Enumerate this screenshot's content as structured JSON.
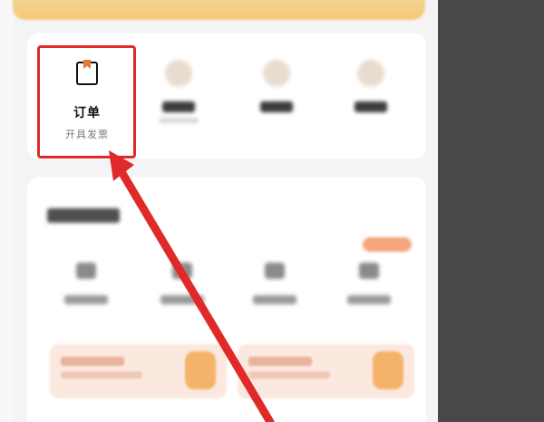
{
  "quick_menu": {
    "order": {
      "title": "订单",
      "subtitle": "开具发票",
      "icon": "order-icon"
    }
  },
  "annotation": {
    "highlight_color": "#e02a2a",
    "arrow_color": "#e02a2a"
  },
  "colors": {
    "background": "#4a4a4a",
    "card": "#ffffff",
    "banner": "#f6c879",
    "accent": "#e07b3c"
  }
}
